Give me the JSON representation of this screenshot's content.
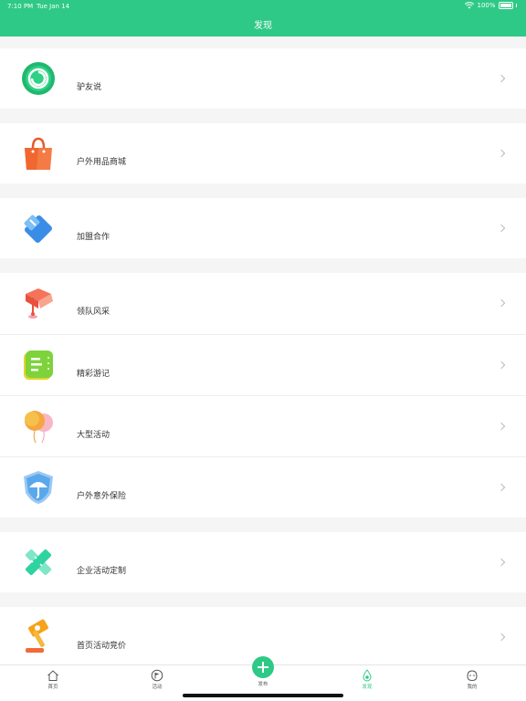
{
  "status_bar": {
    "time": "7:10 PM",
    "date": "Tue Jan 14",
    "battery": "100%"
  },
  "header": {
    "title": "发现"
  },
  "items": [
    {
      "label": "驴友说",
      "icon": "chat-ring-icon"
    },
    {
      "label": "户外用品商城",
      "icon": "shopping-bag-icon"
    },
    {
      "label": "加盟合作",
      "icon": "card-clip-icon"
    },
    {
      "label": "领队风采",
      "icon": "map-pin-flag-icon"
    },
    {
      "label": "精彩游记",
      "icon": "notebook-icon"
    },
    {
      "label": "大型活动",
      "icon": "balloons-icon"
    },
    {
      "label": "户外意外保险",
      "icon": "umbrella-shield-icon"
    },
    {
      "label": "企业活动定制",
      "icon": "pencil-ruler-icon"
    },
    {
      "label": "首页活动竞价",
      "icon": "auction-hammer-icon"
    }
  ],
  "tabbar": {
    "home": "首页",
    "activity": "活动",
    "publish": "发布",
    "discover": "发现",
    "mine": "我的"
  },
  "colors": {
    "accent": "#2ec986"
  }
}
